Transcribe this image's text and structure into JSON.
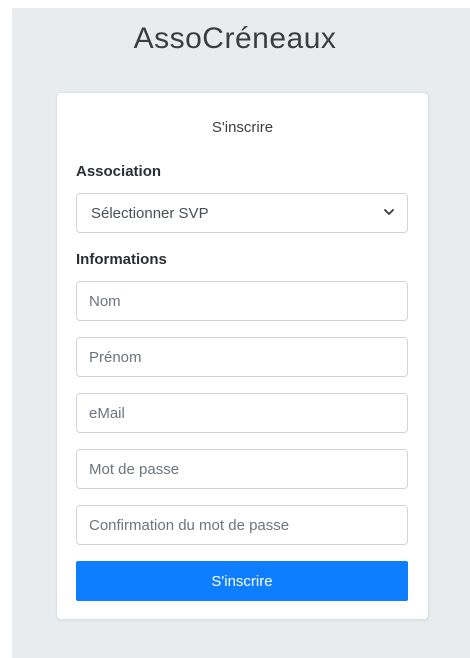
{
  "app": {
    "title": "AssoCréneaux"
  },
  "form": {
    "title": "S'inscrire",
    "association_label": "Association",
    "association_select": {
      "selected": "Sélectionner SVP",
      "icon": "chevron-down-icon"
    },
    "informations_label": "Informations",
    "fields": {
      "nom": {
        "placeholder": "Nom",
        "value": ""
      },
      "prenom": {
        "placeholder": "Prénom",
        "value": ""
      },
      "email": {
        "placeholder": "eMail",
        "value": ""
      },
      "password": {
        "placeholder": "Mot de passe",
        "value": ""
      },
      "password_confirm": {
        "placeholder": "Confirmation du mot de passe",
        "value": ""
      }
    },
    "submit_label": "S'inscrire"
  },
  "colors": {
    "page_background": "#e9ecef",
    "primary_button": "#0d7eff",
    "border": "#ced4da"
  }
}
